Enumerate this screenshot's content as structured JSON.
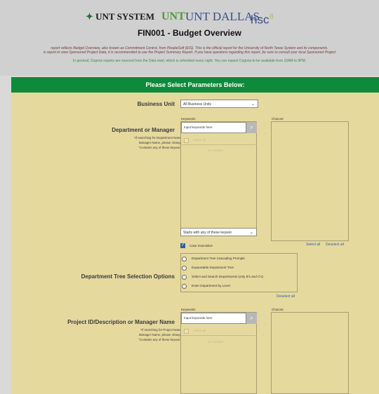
{
  "header": {
    "logos": [
      "UNT SYSTEM",
      "UNT",
      "UNT DALLAS",
      "hsc"
    ],
    "title": "FIN001 - Budget Overview",
    "notes": [
      "report reflects Budget Overview, also known as Commitment Control, from PeopleSoft (EIS). This is the official report for the University of North Texas System and its components.",
      "is report to view Sponsored Project Data, it is recommended to use the Project Summary Report. If you have questions regarding this report, be sure to consult your local Sponsored Project",
      "In general, Cognos reports are sourced from the Data mart, which is refreshed every night. You can expect Cognos to be available from 10AM to 9PM."
    ]
  },
  "banner": "Please Select Parameters Below:",
  "business_unit": {
    "label": "Business Unit",
    "value": "All Business Units"
  },
  "department": {
    "label": "Department or Manager",
    "hint": [
      "*If searching for Department Name or",
      "Manager Name, please change to",
      "\"Contains any of these keywords.\""
    ],
    "keywords_label": "Keywords:",
    "choices_label": "Choices:",
    "placeholder": "Input keywords here",
    "select_all": "Select all",
    "no_results": "No Results",
    "match_mode": "Starts with any of these keywor",
    "case_insensitive": "Case Insensitive",
    "select_all_link": "Select all",
    "deselect_all_link": "Deselect all"
  },
  "tree": {
    "label": "Department Tree Selection Options",
    "options": [
      "Department Tree Cascading Prompts",
      "Expandable Department Tree",
      "Select and Search Departments (only B's and C's)",
      "Enter Department by Level"
    ],
    "deselect_all": "Deselect all"
  },
  "project": {
    "label": "Project ID/Description or Manager Name",
    "hint": [
      "*If searching for Project Name or",
      "Manager Name, please change to",
      "\"Contains any of these keywords.\""
    ],
    "keywords_label": "Keywords:",
    "choices_label": "Choices:",
    "placeholder": "Input keywords here",
    "select_all": "Select all",
    "no_results": "No Results"
  }
}
